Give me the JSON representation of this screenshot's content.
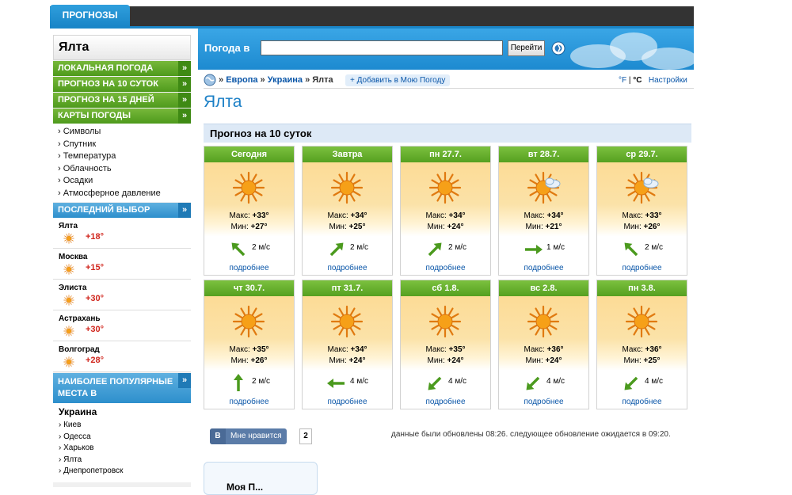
{
  "top_tab": "ПРОГНОЗЫ",
  "sidebar": {
    "city": "Ялта",
    "green_items": [
      {
        "label": "ЛОКАЛЬНАЯ ПОГОДА",
        "arrow": "»"
      },
      {
        "label": "ПРОГНОЗ НА 10 СУТОК",
        "arrow": "»"
      },
      {
        "label": "ПРОГНОЗ НА 15 ДНЕЙ",
        "arrow": "»"
      },
      {
        "label": "КАРТЫ ПОГОДЫ",
        "arrow": "»"
      }
    ],
    "map_links": [
      "Символы",
      "Спутник",
      "Температура",
      "Облачность",
      "Осадки",
      "Атмосферное давление"
    ],
    "recent_title": "ПОСЛЕДНИЙ ВЫБОР",
    "recent": [
      {
        "city": "Ялта",
        "temp": "+18°"
      },
      {
        "city": "Москва",
        "temp": "+15°"
      },
      {
        "city": "Элиста",
        "temp": "+30°"
      },
      {
        "city": "Астрахань",
        "temp": "+30°"
      },
      {
        "city": "Волгоград",
        "temp": "+28°"
      }
    ],
    "popular_title": "НАИБОЛЕЕ ПОПУЛЯРНЫЕ МЕСТА В",
    "country": "Украина",
    "places": [
      "Киев",
      "Одесса",
      "Харьков",
      "Ялта",
      "Днепропетровск"
    ]
  },
  "search": {
    "label": "Погода в",
    "value": "",
    "go_label": "Перейти"
  },
  "breadcrumb": {
    "europe": "Европа",
    "ukraine": "Украина",
    "current": "Ялта",
    "add_label": "+ Добавить в Мою Погоду"
  },
  "units": {
    "f": "°F",
    "c": "°C",
    "settings": "Настройки"
  },
  "page_title": "Ялта",
  "forecast": {
    "title": "Прогноз на 10 суток",
    "max_prefix": "Макс:",
    "min_prefix": "Мин:",
    "more_label": "подробнее",
    "days": [
      {
        "day": "Сегодня",
        "max": "+33°",
        "min": "+27°",
        "wind": "2 м/с",
        "icon": "sun-icon",
        "wind_dir": "nw"
      },
      {
        "day": "Завтра",
        "max": "+34°",
        "min": "+25°",
        "wind": "2 м/с",
        "icon": "sun-icon",
        "wind_dir": "ne"
      },
      {
        "day": "пн 27.7.",
        "max": "+34°",
        "min": "+24°",
        "wind": "2 м/с",
        "icon": "sun-icon",
        "wind_dir": "ne"
      },
      {
        "day": "вт 28.7.",
        "max": "+34°",
        "min": "+21°",
        "wind": "1 м/с",
        "icon": "sun-cloud-icon",
        "wind_dir": "e"
      },
      {
        "day": "ср 29.7.",
        "max": "+33°",
        "min": "+26°",
        "wind": "2 м/с",
        "icon": "sun-cloud-icon",
        "wind_dir": "nw"
      },
      {
        "day": "чт 30.7.",
        "max": "+35°",
        "min": "+26°",
        "wind": "2 м/с",
        "icon": "sun-icon",
        "wind_dir": "n"
      },
      {
        "day": "пт 31.7.",
        "max": "+34°",
        "min": "+24°",
        "wind": "4 м/с",
        "icon": "sun-icon",
        "wind_dir": "w"
      },
      {
        "day": "сб 1.8.",
        "max": "+35°",
        "min": "+24°",
        "wind": "4 м/с",
        "icon": "sun-icon",
        "wind_dir": "sw"
      },
      {
        "day": "вс 2.8.",
        "max": "+36°",
        "min": "+24°",
        "wind": "4 м/с",
        "icon": "sun-icon",
        "wind_dir": "sw"
      },
      {
        "day": "пн 3.8.",
        "max": "+36°",
        "min": "+25°",
        "wind": "4 м/с",
        "icon": "sun-icon",
        "wind_dir": "sw"
      }
    ]
  },
  "like": {
    "vk": "В",
    "label": "Мне нравится",
    "count": "2"
  },
  "updated_text": "данные были обновлены 08:26. следующее обновление ожидается в 09:20.",
  "my_weather_title": "Моя П...",
  "colors": {
    "accent_blue": "#1a86c8",
    "green": "#55a020",
    "temp_red": "#d0261d",
    "link": "#0a56a8"
  }
}
